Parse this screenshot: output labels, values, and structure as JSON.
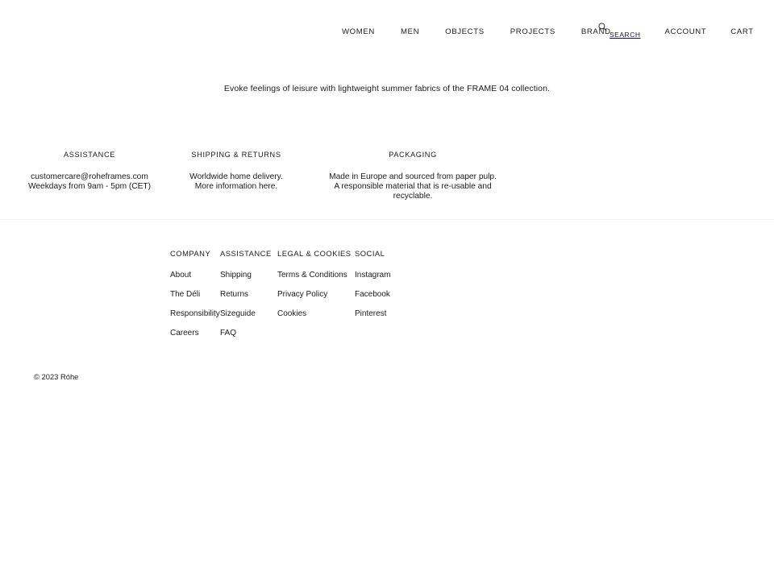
{
  "header": {
    "logo_alt": "Rohe",
    "nav_main": [
      {
        "label": "WOMEN",
        "name": "nav-item-women"
      },
      {
        "label": "MEN",
        "name": "nav-item-men"
      },
      {
        "label": "OBJECTS",
        "name": "nav-item-objects"
      },
      {
        "label": "PROJECTS",
        "name": "nav-item-projects"
      },
      {
        "label": "BRAND",
        "name": "nav-item-brand"
      }
    ],
    "search": {
      "icon": "search-icon",
      "label": "SEARCH"
    },
    "nav_right": [
      {
        "label": "ACCOUNT",
        "name": "nav-item-account"
      },
      {
        "label": "CART",
        "name": "nav-item-cart"
      }
    ]
  },
  "hero": {
    "tagline": "Evoke feelings of leisure with lightweight summer fabrics of the FRAME 04 collection."
  },
  "info": {
    "columns": [
      {
        "title": "ASSISTANCE",
        "lines": [
          "customercare@roheframes.com",
          "Weekdays from 9am - 5pm (CET)"
        ]
      },
      {
        "title": "SHIPPING & RETURNS",
        "lines": [
          "Worldwide home delivery.",
          "More information here."
        ]
      },
      {
        "title": "PACKAGING",
        "lines": [
          "Made in Europe and sourced from paper pulp.",
          "A responsible material that is re-usable and",
          "recyclable."
        ]
      }
    ]
  },
  "footer": {
    "columns": [
      {
        "heading": "COMPANY",
        "links": [
          "About",
          "The Déli",
          "Responsibility",
          "Careers"
        ]
      },
      {
        "heading": "ASSISTANCE",
        "links": [
          "Shipping",
          "Returns",
          "Sizeguide",
          "FAQ"
        ]
      },
      {
        "heading": "LEGAL & COOKIES",
        "links": [
          "Terms & Conditions",
          "Privacy Policy",
          "Cookies"
        ]
      },
      {
        "heading": "SOCIAL",
        "links": [
          "Instagram",
          "Facebook",
          "Pinterest"
        ]
      }
    ],
    "copyright": "© 2023 Róhe"
  },
  "colors": {
    "background": "#ffffff",
    "text": "#1a1a1a",
    "divider": "#f2f2f4"
  }
}
